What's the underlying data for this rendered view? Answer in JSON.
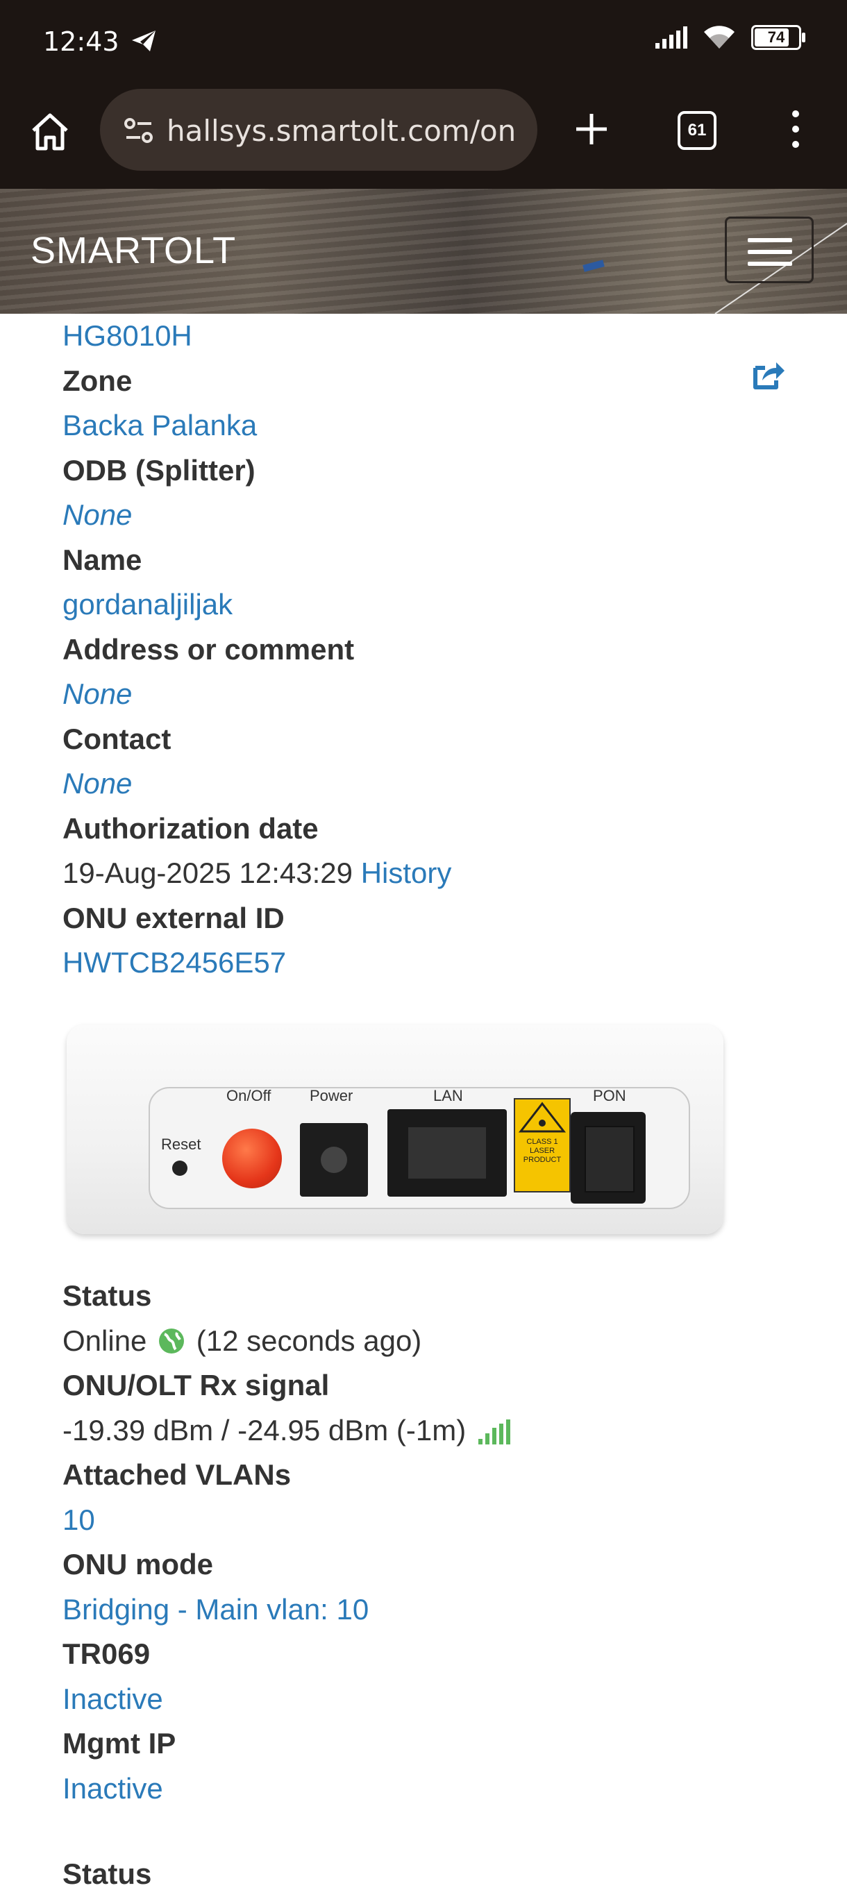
{
  "status_bar": {
    "time": "12:43",
    "battery": "74"
  },
  "browser": {
    "url": "hallsys.smartolt.com/on",
    "tab_count": "61"
  },
  "site": {
    "brand": "SMARTOLT"
  },
  "details": {
    "model_value": "HG8010H",
    "zone_label": "Zone",
    "zone_value": "Backa Palanka",
    "odb_label": "ODB (Splitter)",
    "odb_value": "None",
    "name_label": "Name",
    "name_value": "gordanaljiljak",
    "address_label": "Address or comment",
    "address_value": "None",
    "contact_label": "Contact",
    "contact_value": "None",
    "auth_label": "Authorization date",
    "auth_value": "19-Aug-2025 12:43:29",
    "history_link": "History",
    "ext_id_label": "ONU external ID",
    "ext_id_value": "HWTCB2456E57"
  },
  "device_image": {
    "labels": {
      "reset": "Reset",
      "onoff": "On/Off",
      "power": "Power",
      "lan": "LAN",
      "pon": "PON",
      "laser": "CLASS 1 LASER PRODUCT"
    }
  },
  "status": {
    "status_label": "Status",
    "status_value": "Online",
    "status_ago": "(12 seconds ago)",
    "signal_label": "ONU/OLT Rx signal",
    "signal_value": "-19.39 dBm / -24.95 dBm (-1m)",
    "vlans_label": "Attached VLANs",
    "vlans_value": "10",
    "mode_label": "ONU mode",
    "mode_value": "Bridging - Main vlan: 10",
    "tr069_label": "TR069",
    "tr069_value": "Inactive",
    "mgmt_label": "Mgmt IP",
    "mgmt_value": "Inactive",
    "next_section_label": "Status"
  },
  "colors": {
    "link": "#2a7ab9",
    "online_green": "#5cb85c",
    "topbar": "#1c1512"
  }
}
